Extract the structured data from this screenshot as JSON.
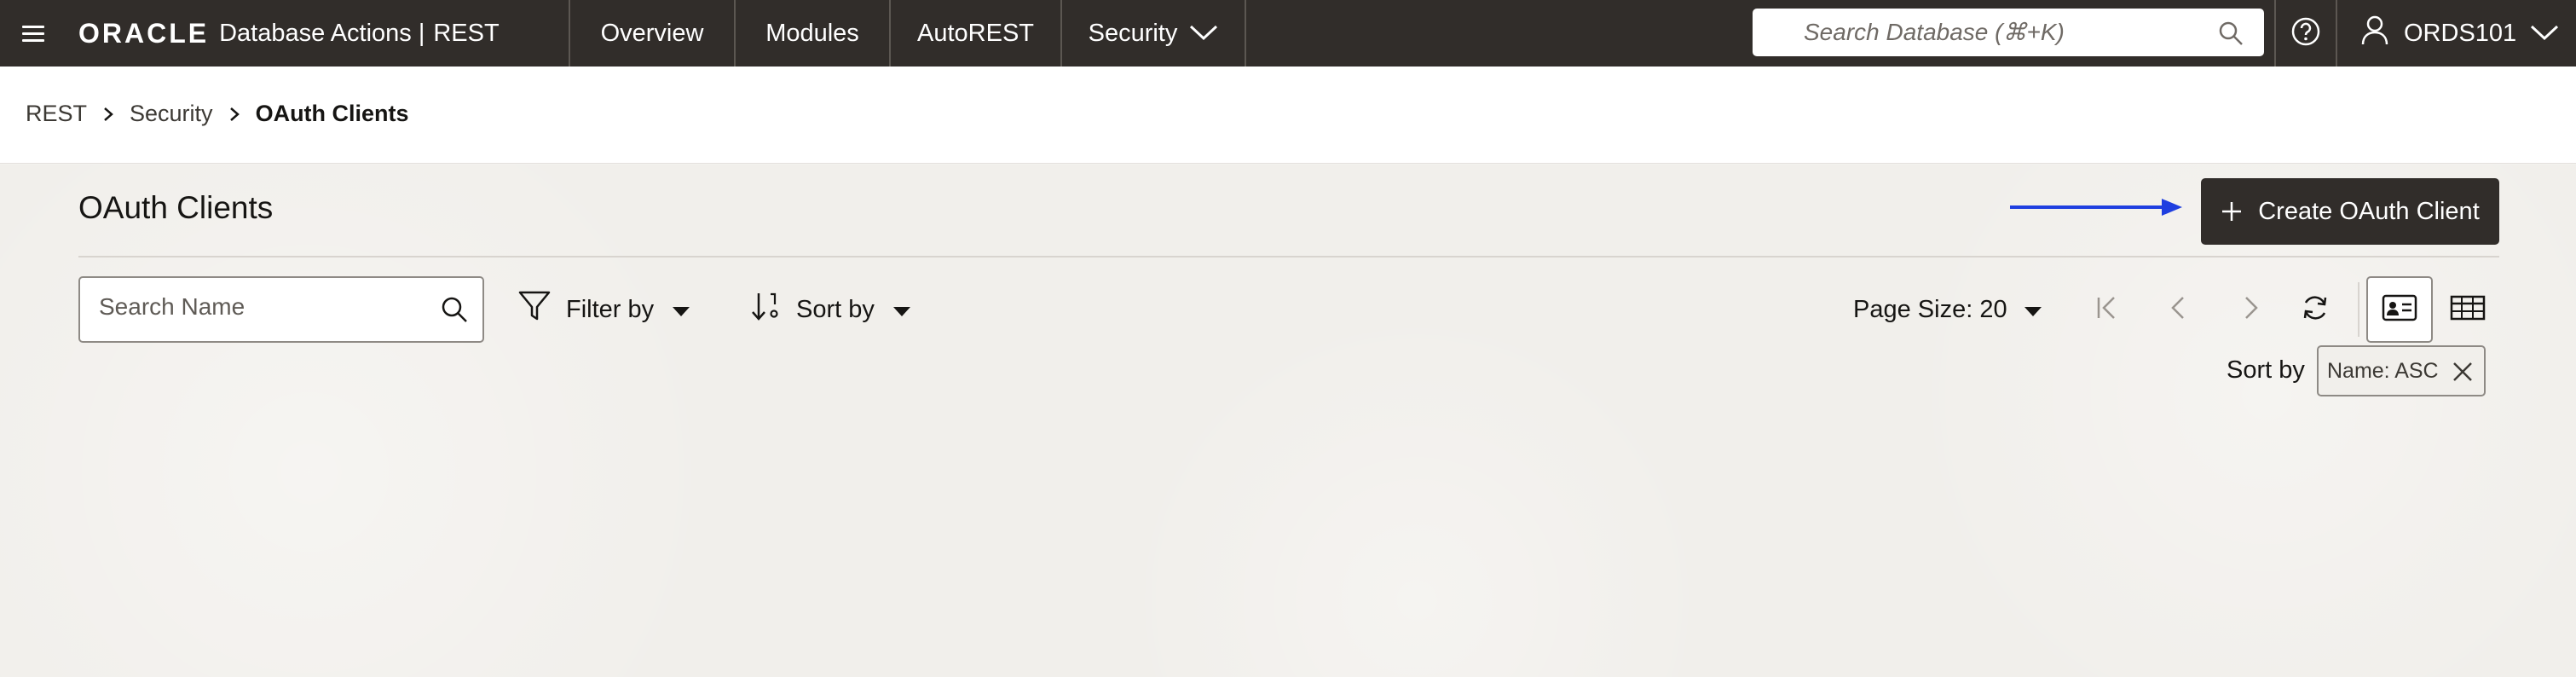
{
  "topbar": {
    "brand_logo": "ORACLE",
    "brand_product": "Database Actions",
    "brand_separator": "|",
    "brand_section": "REST",
    "tabs": [
      {
        "label": "Overview"
      },
      {
        "label": "Modules"
      },
      {
        "label": "AutoREST"
      },
      {
        "label": "Security"
      }
    ],
    "search_placeholder": "Search Database (⌘+K)",
    "user_name": "ORDS101"
  },
  "breadcrumb": {
    "items": [
      {
        "label": "REST"
      },
      {
        "label": "Security"
      },
      {
        "label": "OAuth Clients"
      }
    ]
  },
  "page": {
    "title": "OAuth Clients",
    "create_button_label": "Create OAuth Client",
    "name_search_placeholder": "Search Name",
    "filter_label": "Filter by",
    "sort_label": "Sort by",
    "page_size_label": "Page Size: 20",
    "applied_sort_label": "Sort by",
    "applied_sort_chip": "Name: ASC"
  },
  "colors": {
    "topbar_bg": "#312d2a",
    "primary_button_bg": "#312d2a",
    "annotation_arrow": "#1f3fe0"
  },
  "icons": [
    "hamburger-icon",
    "search-icon",
    "chevron-down-icon",
    "help-icon",
    "user-icon",
    "chevron-right-icon",
    "plus-icon",
    "filter-icon",
    "sort-icon",
    "caret-down-icon",
    "first-page-icon",
    "previous-page-icon",
    "next-page-icon",
    "refresh-icon",
    "card-view-icon",
    "table-view-icon",
    "close-icon"
  ]
}
